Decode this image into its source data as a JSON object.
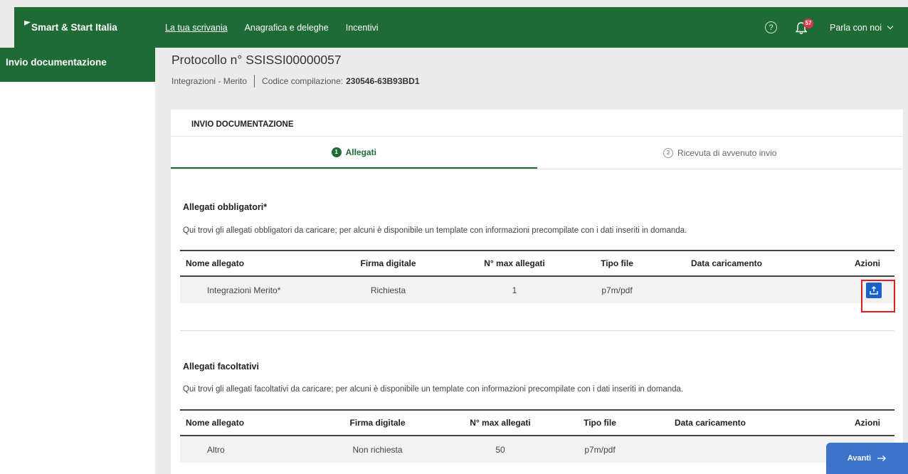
{
  "brand": "Smart & Start Italia",
  "nav": [
    "La tua scrivania",
    "Anagrafica e deleghe",
    "Incentivi"
  ],
  "notifications_count": "57",
  "talk_label": "Parla con noi",
  "sidebar": {
    "active_item": "Invio documentazione"
  },
  "header": {
    "protocol": "Protocollo n° SSISSI00000057",
    "breadcrumb": "Integrazioni - Merito",
    "code_label": "Codice compilazione:",
    "code_value": "230546-63B93BD1"
  },
  "card_title": "INVIO DOCUMENTAZIONE",
  "tabs": [
    {
      "num": "1",
      "label": "Allegati"
    },
    {
      "num": "2",
      "label": "Ricevuta di avvenuto invio"
    }
  ],
  "mandatory": {
    "title": "Allegati obbligatori*",
    "description": "Qui trovi gli allegati obbligatori da caricare; per alcuni è disponibile un template con informazioni precompilate con i dati inseriti in domanda.",
    "columns": [
      "Nome allegato",
      "Firma digitale",
      "N° max allegati",
      "Tipo file",
      "Data caricamento",
      "Azioni"
    ],
    "row": {
      "name": "Integrazioni Merito*",
      "signature": "Richiesta",
      "max": "1",
      "type": "p7m/pdf",
      "date": ""
    }
  },
  "optional": {
    "title": "Allegati facoltativi",
    "description": "Qui trovi gli allegati facoltativi da caricare; per alcuni è disponibile un template con informazioni precompilate con i dati inseriti in domanda.",
    "columns": [
      "Nome allegato",
      "Firma digitale",
      "N° max allegati",
      "Tipo file",
      "Data caricamento",
      "Azioni"
    ],
    "row": {
      "name": "Altro",
      "signature": "Non richiesta",
      "max": "50",
      "type": "p7m/pdf",
      "date": ""
    }
  },
  "next_button": "Avanti",
  "colors": {
    "primary_green": "#1e6b35",
    "action_blue": "#1a62c9",
    "highlight_red": "#e01c1c"
  }
}
